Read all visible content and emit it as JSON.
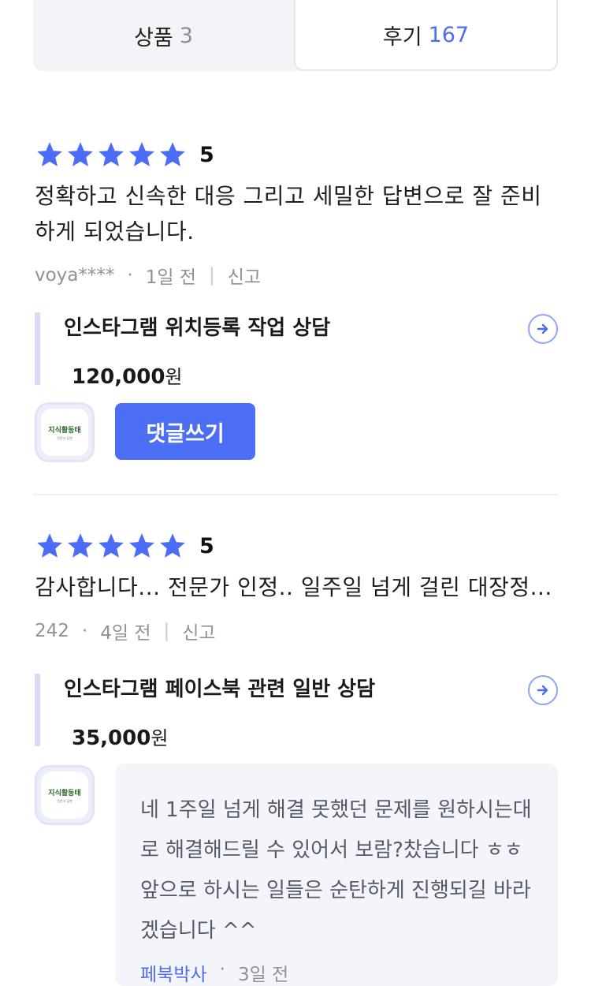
{
  "tabs": [
    {
      "label": "상품",
      "count": "3"
    },
    {
      "label": "후기",
      "count": "167"
    }
  ],
  "reviews": [
    {
      "score": "5",
      "text": "정확하고 신속한 대응 그리고 세밀한 답변으로 잘 준비하게 되었습니다.",
      "author": "voya****",
      "time": "1일 전",
      "report": "신고",
      "product_name": "인스타그램 위치등록 작업 상담",
      "product_price": "120,000",
      "currency": "원",
      "reply_button": "댓글쓰기"
    },
    {
      "score": "5",
      "text": "감사합니다... 전문가 인정.. 일주일 넘게 걸린 대장정...",
      "author": "242",
      "time": "4일 전",
      "report": "신고",
      "product_name": "인스타그램 페이스북 관련 일반 상담",
      "product_price": "35,000",
      "currency": "원"
    }
  ],
  "seller_reply": {
    "text": "네 1주일 넘게 해결 못했던 문제를 원하시는대로 해결해드릴 수 있어서 보람?찼습니다 ㅎㅎ 앞으로 하시는 일들은 순탄하게 진행되길 바라겠습니다 ^^",
    "author": "페북박사",
    "time": "3일 전"
  },
  "seller_logo": {
    "title": "지식활동태",
    "subtitle": "전문가 답변"
  },
  "colors": {
    "accent": "#4c6ef5",
    "star": "#4a6cf7"
  }
}
